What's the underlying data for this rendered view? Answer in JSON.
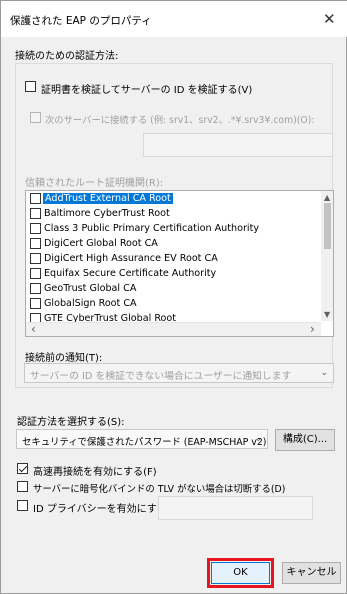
{
  "window": {
    "title": "保護された EAP のプロパティ",
    "close_glyph": "✕"
  },
  "connect_auth": {
    "label": "接続のための認証方法:",
    "verify_cert_label": "証明書を検証してサーバーの ID を検証する(V)",
    "verify_cert_checked": false,
    "connect_servers_label": "次のサーバーに接続する (例: srv1、srv2、.*¥.srv3¥.com)(O):",
    "servers_value": ""
  },
  "root_ca": {
    "label": "信頼されたルート証明機関(R):",
    "items": [
      {
        "name": "AddTrust External CA Root",
        "checked": false,
        "selected": true
      },
      {
        "name": "Baltimore CyberTrust Root",
        "checked": false
      },
      {
        "name": "Class 3 Public Primary Certification Authority",
        "checked": false
      },
      {
        "name": "DigiCert Global Root CA",
        "checked": false
      },
      {
        "name": "DigiCert High Assurance EV Root CA",
        "checked": false
      },
      {
        "name": "Equifax Secure Certificate Authority",
        "checked": false
      },
      {
        "name": "GeoTrust Global CA",
        "checked": false
      },
      {
        "name": "GlobalSign Root CA",
        "checked": false
      },
      {
        "name": "GTE CyberTrust Global Root",
        "checked": false
      }
    ]
  },
  "notify": {
    "label": "接続前の通知(T):",
    "selected": "サーバーの ID を検証できない場合にユーザーに通知します"
  },
  "auth_method": {
    "label": "認証方法を選択する(S):",
    "selected": "セキュリティで保護されたパスワード (EAP-MSCHAP v2)",
    "configure_label": "構成(C)..."
  },
  "options": {
    "fast_reconnect": {
      "label": "高速再接続を有効にする(F)",
      "checked": true
    },
    "tlv_disconnect": {
      "label": "サーバーに暗号化バインドの TLV がない場合は切断する(D)",
      "checked": false
    },
    "identity_privacy": {
      "label": "ID プライバシーを有効にする(I)",
      "checked": false,
      "value": ""
    }
  },
  "buttons": {
    "ok": "OK",
    "cancel": "キャンセル"
  },
  "scroll_glyphs": {
    "up": "▲",
    "down": "▼",
    "left": "‹",
    "right": "›",
    "combo": "⌄"
  }
}
